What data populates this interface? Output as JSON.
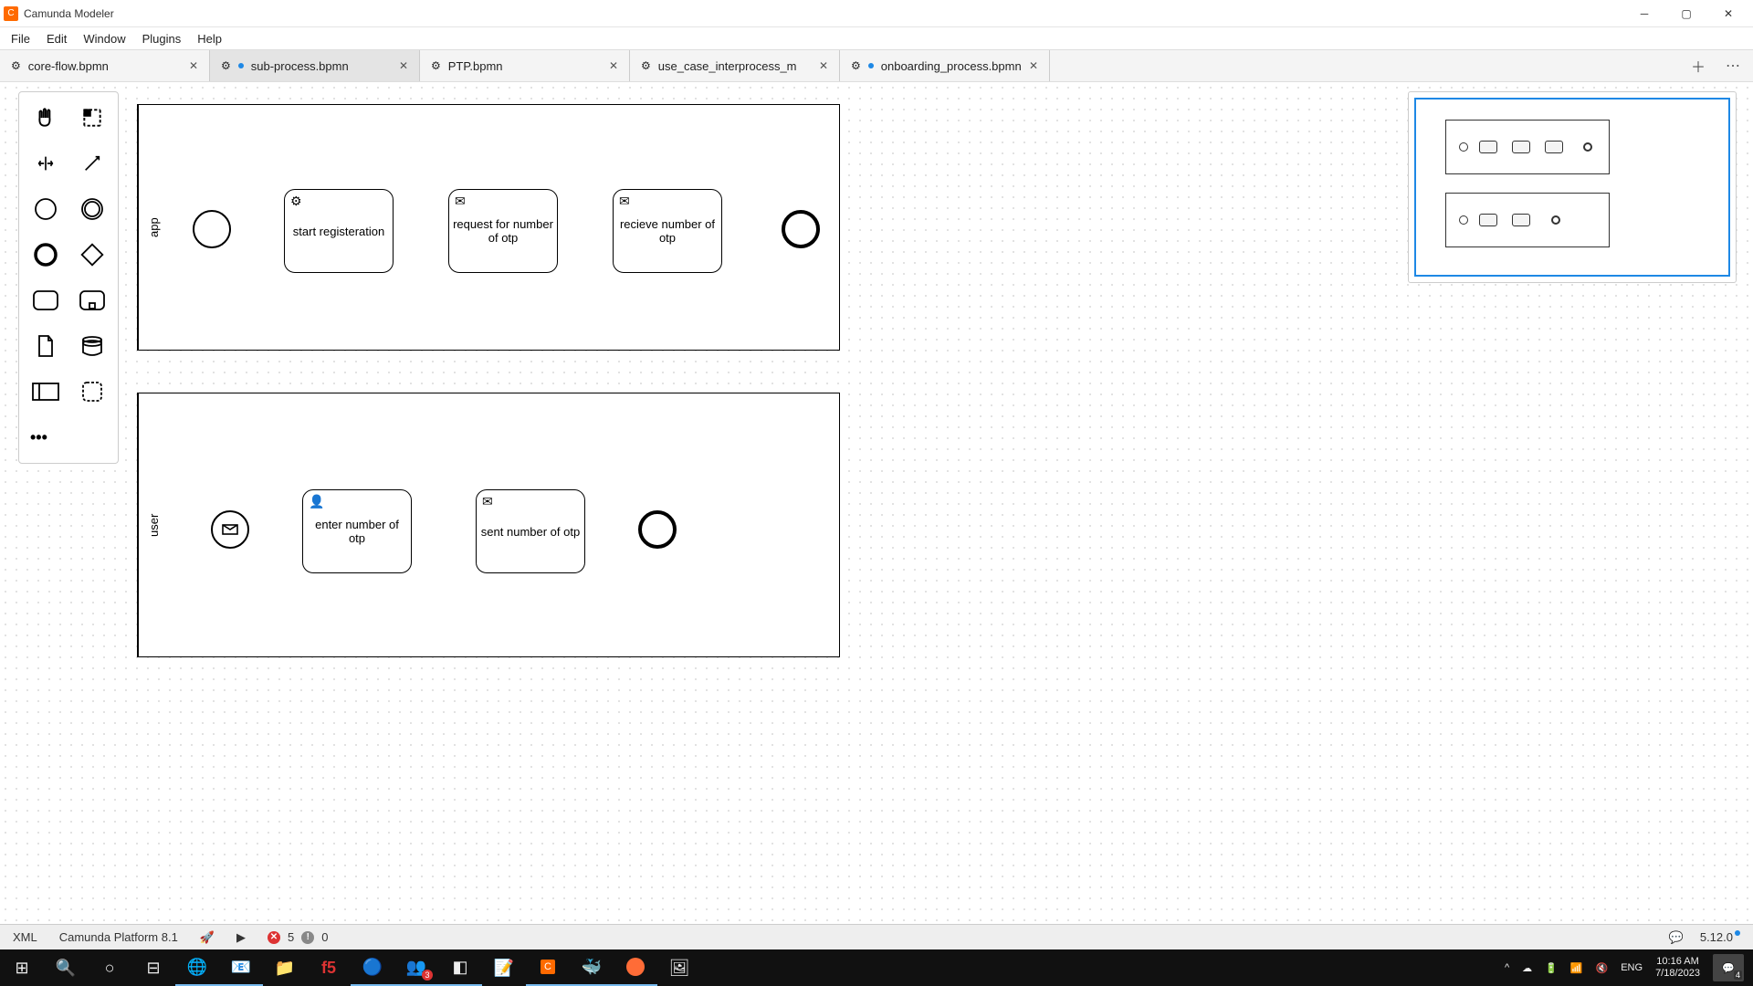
{
  "app": {
    "title": "Camunda Modeler"
  },
  "menu": [
    "File",
    "Edit",
    "Window",
    "Plugins",
    "Help"
  ],
  "tabs": [
    {
      "label": "core-flow.bpmn",
      "modified": false
    },
    {
      "label": "sub-process.bpmn",
      "modified": true,
      "active": true
    },
    {
      "label": "PTP.bpmn",
      "modified": false
    },
    {
      "label": "use_case_interprocess_m",
      "modified": false
    },
    {
      "label": "onboarding_process.bpmn",
      "modified": true
    }
  ],
  "diagram": {
    "pool_app_label": "app",
    "pool_user_label": "user",
    "tasks": {
      "start_registration": "start registeration",
      "request_otp": "request for number of otp",
      "receive_otp": "recieve number of otp",
      "enter_otp": "enter number of otp",
      "sent_otp": "sent number of otp"
    }
  },
  "status": {
    "xml": "XML",
    "platform": "Camunda Platform 8.1",
    "errors": "5",
    "warnings": "0",
    "version": "5.12.0"
  },
  "taskbar": {
    "lang": "ENG",
    "time": "10:16 AM",
    "date": "7/18/2023",
    "notif_count": "4",
    "teams_badge": "3"
  }
}
